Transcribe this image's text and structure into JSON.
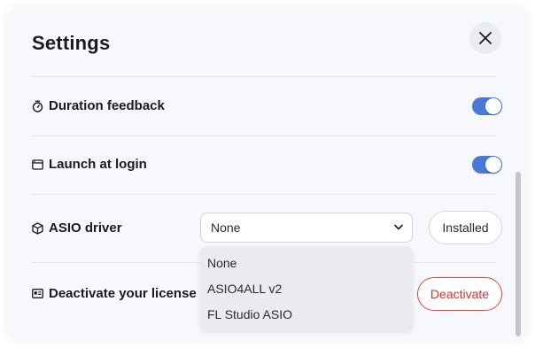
{
  "title": "Settings",
  "close_icon": "close-icon",
  "rows": [
    {
      "label": "Duration feedback",
      "icon": "stopwatch-icon",
      "control": "toggle",
      "enabled": true
    },
    {
      "label": "Launch at login",
      "icon": "window-icon",
      "control": "toggle",
      "enabled": true
    },
    {
      "label": "ASIO driver",
      "icon": "cube-icon",
      "control": "select"
    },
    {
      "label": "Deactivate your license",
      "icon": "id-card-icon",
      "control": "button"
    }
  ],
  "asio": {
    "selected": "None",
    "options": [
      "None",
      "ASIO4ALL v2",
      "FL Studio ASIO"
    ],
    "installed_label": "Installed"
  },
  "license": {
    "deactivate_label": "Deactivate"
  },
  "colors": {
    "toggle_on": "#4a78d8",
    "danger": "#d6342a",
    "panel_bg": "#f6f8fb"
  }
}
